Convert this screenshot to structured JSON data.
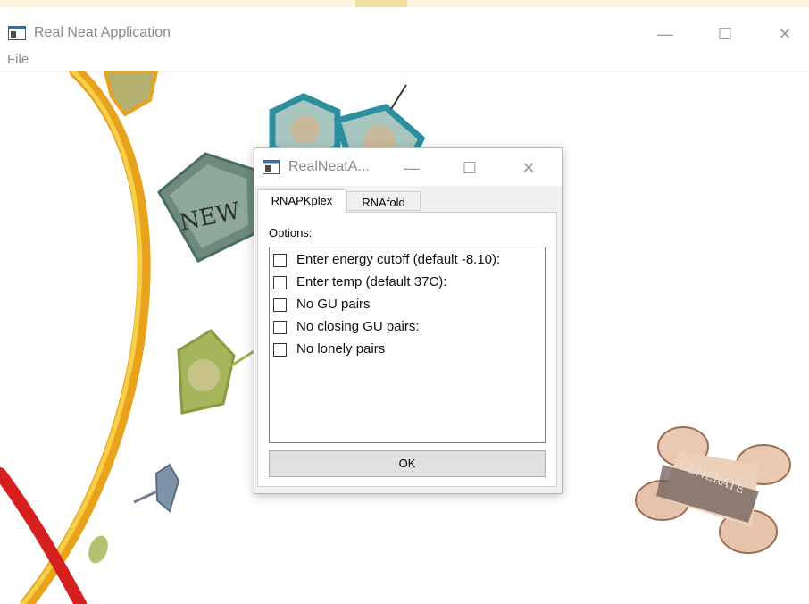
{
  "window": {
    "title": "Real Neat Application",
    "controls": {
      "minimize": "—",
      "maximize": "☐",
      "close": "✕"
    }
  },
  "menubar": {
    "items": [
      "File"
    ]
  },
  "artwork": {
    "new_label": "NEW",
    "generate_label": "GENERATE"
  },
  "dialog": {
    "title": "RealNeatA...",
    "controls": {
      "minimize": "—",
      "maximize": "☐",
      "close": "✕"
    },
    "tabs": [
      {
        "label": "RNAPKplex",
        "active": true
      },
      {
        "label": "RNAfold",
        "active": false
      }
    ],
    "options_label": "Options:",
    "options": [
      {
        "label": "Enter energy cutoff (default -8.10):",
        "checked": false
      },
      {
        "label": "Enter temp (default 37C):",
        "checked": false
      },
      {
        "label": "No GU pairs",
        "checked": false
      },
      {
        "label": "No closing GU pairs:",
        "checked": false
      },
      {
        "label": "No lonely pairs",
        "checked": false
      }
    ],
    "ok_label": "OK"
  },
  "colors": {
    "title_text": "#8a8a8a",
    "button_face": "#e1e1e1",
    "dialog_body": "#f0f0f0"
  }
}
